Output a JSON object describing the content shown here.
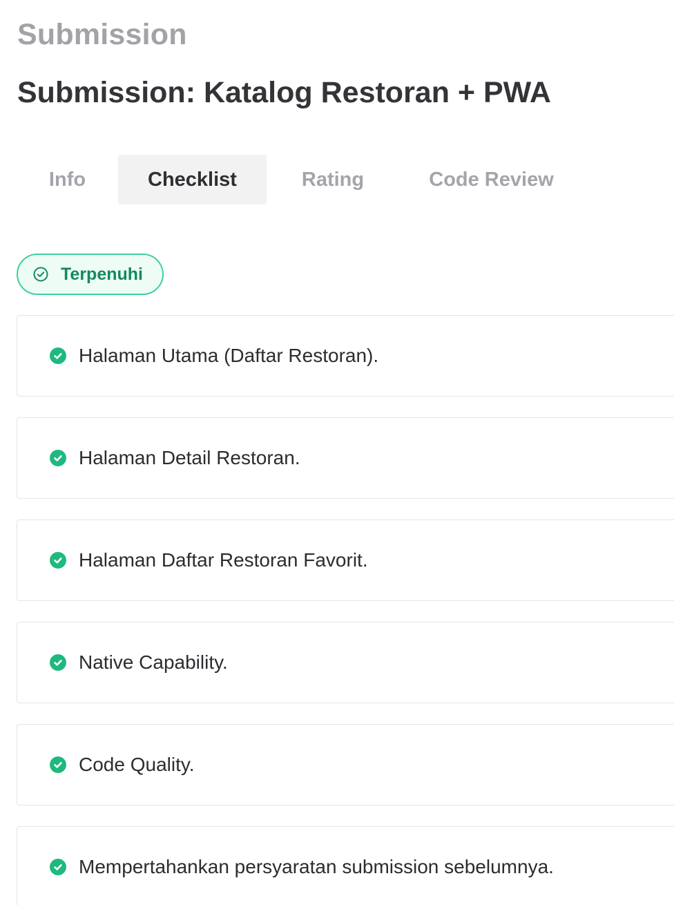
{
  "header": {
    "section_title": "Submission",
    "page_title": "Submission: Katalog Restoran + PWA"
  },
  "tabs": [
    {
      "label": "Info",
      "active": false
    },
    {
      "label": "Checklist",
      "active": true
    },
    {
      "label": "Rating",
      "active": false
    },
    {
      "label": "Code Review",
      "active": false
    }
  ],
  "status": {
    "label": "Terpenuhi",
    "icon": "check-circle-outline-icon"
  },
  "checklist": {
    "item_icon": "check-circle-filled-icon",
    "items": [
      {
        "label": "Halaman Utama (Daftar Restoran)."
      },
      {
        "label": "Halaman Detail Restoran."
      },
      {
        "label": "Halaman Daftar Restoran Favorit."
      },
      {
        "label": "Native Capability."
      },
      {
        "label": "Code Quality."
      },
      {
        "label": "Mempertahankan persyaratan submission sebelumnya."
      }
    ]
  },
  "colors": {
    "success": "#1fb97f",
    "success_dark": "#138a5e",
    "badge_border": "#3dd19c",
    "badge_bg": "#eefcf6",
    "title_muted": "#a2a2a8",
    "title_dark": "#333338",
    "tab_active_bg": "#f2f2f2"
  }
}
